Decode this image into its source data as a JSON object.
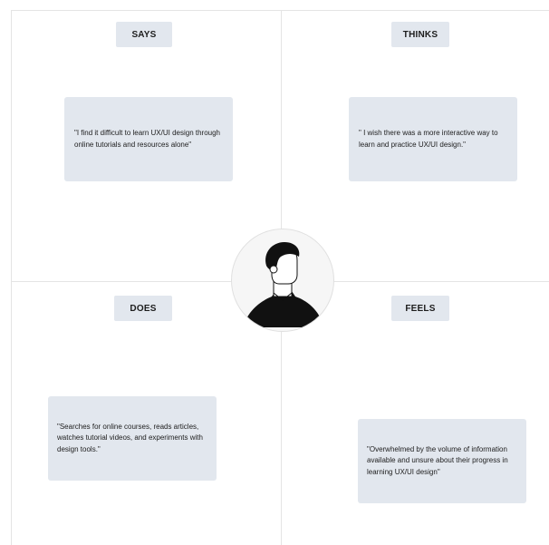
{
  "quadrants": {
    "says": {
      "label": "SAYS",
      "note": "\"I find it difficult to learn UX/UI design through online tutorials and resources alone\""
    },
    "thinks": {
      "label": "THINKS",
      "note": "\" I wish there was a more interactive way to learn and practice UX/UI design.\""
    },
    "does": {
      "label": "DOES",
      "note": "\"Searches for online courses, reads articles, watches tutorial videos, and experiments with design tools.\""
    },
    "feels": {
      "label": "FEELS",
      "note": "\"Overwhelmed by the volume of information available and unsure about their progress in learning UX/UI design\""
    }
  },
  "avatar": {
    "icon": "user-avatar-icon",
    "colors": {
      "figure": "#111111",
      "background": "#f6f6f6"
    }
  },
  "colors": {
    "card": "#e2e7ee",
    "divider": "#e4e4e4",
    "text": "#1d1d1d"
  }
}
